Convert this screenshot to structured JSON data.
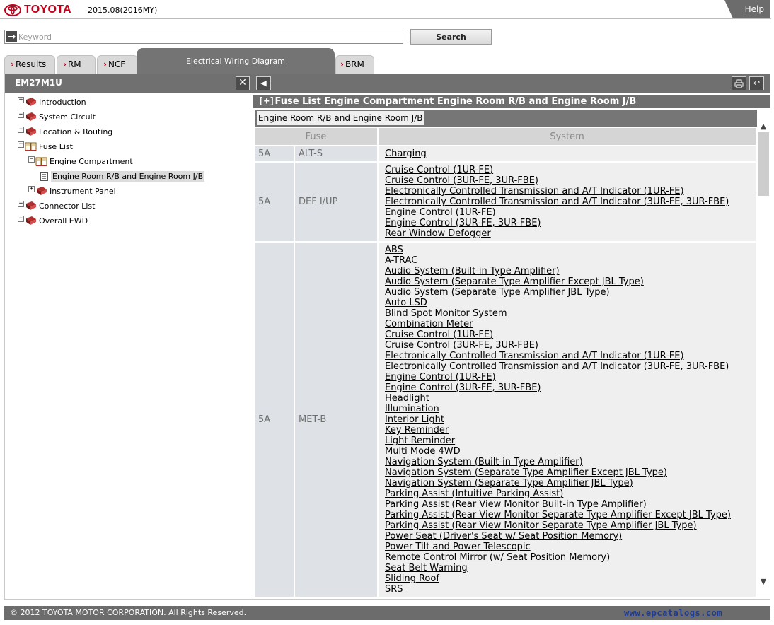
{
  "header": {
    "brand": "TOYOTA",
    "model_year": "2015.08(2016MY)",
    "help_label": "Help"
  },
  "search": {
    "placeholder": "Keyword",
    "button_label": "Search"
  },
  "tabs": {
    "results": "Results",
    "rm": "RM",
    "ncf": "NCF",
    "ewd": "Electrical Wiring Diagram",
    "brm": "BRM"
  },
  "left_panel": {
    "title": "EM27M1U",
    "close_label": "✕",
    "tree": [
      {
        "toggle": "+",
        "label": "Introduction"
      },
      {
        "toggle": "+",
        "label": "System Circuit"
      },
      {
        "toggle": "+",
        "label": "Location & Routing"
      },
      {
        "toggle": "−",
        "label": "Fuse List"
      },
      {
        "toggle": "−",
        "label": "Engine Compartment"
      },
      {
        "toggle": "",
        "label": "Engine Room R/B and Engine Room J/B"
      },
      {
        "toggle": "+",
        "label": "Instrument Panel"
      },
      {
        "toggle": "+",
        "label": "Connector List"
      },
      {
        "toggle": "+",
        "label": "Overall EWD"
      }
    ]
  },
  "right_panel": {
    "title_prefix": "[+]",
    "title": "Fuse List  Engine Compartment  Engine Room R/B and Engine Room J/B",
    "subtitle": "Engine Room R/B and Engine Room J/B",
    "columns": {
      "fuse": "Fuse",
      "system": "System"
    },
    "rows": [
      {
        "amp": "5A",
        "fuse": "ALT-S",
        "systems": [
          "Charging"
        ]
      },
      {
        "amp": "5A",
        "fuse": "DEF I/UP",
        "systems": [
          "Cruise Control (1UR-FE)",
          "Cruise Control (3UR-FE, 3UR-FBE)",
          "Electronically Controlled Transmission and A/T Indicator (1UR-FE)",
          "Electronically Controlled Transmission and A/T Indicator (3UR-FE, 3UR-FBE)",
          "Engine Control (1UR-FE)",
          "Engine Control (3UR-FE, 3UR-FBE)",
          "Rear Window Defogger"
        ]
      },
      {
        "amp": "5A",
        "fuse": "MET-B",
        "systems": [
          "ABS",
          "A-TRAC",
          "Audio System (Built-in Type Amplifier)",
          "Audio System (Separate Type Amplifier Except JBL Type)",
          "Audio System (Separate Type Amplifier JBL Type)",
          "Auto LSD",
          "Blind Spot Monitor System",
          "Combination Meter",
          "Cruise Control (1UR-FE)",
          "Cruise Control (3UR-FE, 3UR-FBE)",
          "Electronically Controlled Transmission and A/T Indicator (1UR-FE)",
          "Electronically Controlled Transmission and A/T Indicator (3UR-FE, 3UR-FBE)",
          "Engine Control (1UR-FE)",
          "Engine Control (3UR-FE, 3UR-FBE)",
          "Headlight",
          "Illumination",
          "Interior Light",
          "Key Reminder",
          "Light Reminder",
          "Multi Mode 4WD",
          "Navigation System (Built-in Type Amplifier)",
          "Navigation System (Separate Type Amplifier Except JBL Type)",
          "Navigation System (Separate Type Amplifier JBL Type)",
          "Parking Assist (Intuitive Parking Assist)",
          "Parking Assist (Rear View Monitor Built-in Type Amplifier)",
          "Parking Assist (Rear View Monitor Separate Type Amplifier Except JBL Type)",
          "Parking Assist (Rear View Monitor Separate Type Amplifier JBL Type)",
          "Power Seat (Driver's Seat w/ Seat Position Memory)",
          "Power Tilt and Power Telescopic",
          "Remote Control Mirror (w/ Seat Position Memory)",
          "Seat Belt Warning",
          "Sliding Roof"
        ],
        "last_plain": "SRS"
      }
    ]
  },
  "footer": {
    "copyright": "© 2012 TOYOTA MOTOR CORPORATION. All Rights Reserved.",
    "watermark": "www.epcatalogs.com"
  },
  "colors": {
    "brand_red": "#c4001a",
    "bar_gray": "#707070",
    "fuse_cell": "#dee2e6",
    "system_cell": "#efefef",
    "watermark_blue": "#1e3b94"
  }
}
